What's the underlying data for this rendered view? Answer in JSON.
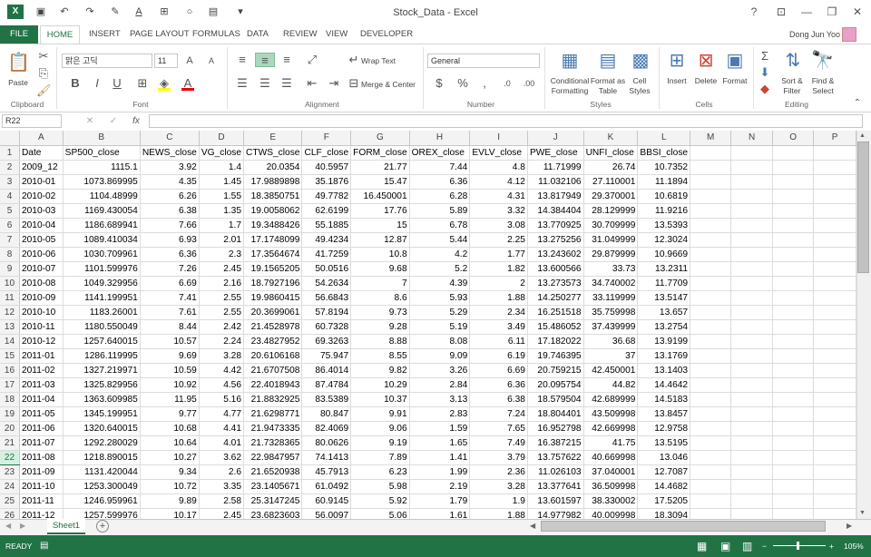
{
  "titlebar": {
    "title": "Stock_Data - Excel",
    "help": "?",
    "minimize": "—",
    "restore": "❐",
    "close": "✕",
    "ribbon_display": "⊡"
  },
  "tabs": {
    "file": "FILE",
    "home": "HOME",
    "insert": "INSERT",
    "page_layout": "PAGE LAYOUT",
    "formulas": "FORMULAS",
    "data": "DATA",
    "review": "REVIEW",
    "view": "VIEW",
    "developer": "DEVELOPER",
    "user": "Dong Jun Yoo"
  },
  "ribbon": {
    "paste": "Paste",
    "clipboard": "Clipboard",
    "font_name": "맑은 고딕",
    "font_size": "11",
    "font": "Font",
    "bold": "B",
    "italic": "I",
    "underline": "U",
    "wrap_text": "Wrap Text",
    "merge_center": "Merge & Center",
    "alignment": "Alignment",
    "number_format": "General",
    "percent": "%",
    "comma": ",",
    "number": "Number",
    "cond_fmt1": "Conditional",
    "cond_fmt2": "Formatting",
    "fmt_table1": "Format as",
    "fmt_table2": "Table",
    "cell_styles1": "Cell",
    "cell_styles2": "Styles",
    "styles": "Styles",
    "insert": "Insert",
    "delete": "Delete",
    "format": "Format",
    "cells": "Cells",
    "sort1": "Sort &",
    "sort2": "Filter",
    "find1": "Find &",
    "find2": "Select",
    "editing": "Editing"
  },
  "formula": {
    "namebox": "R22",
    "fx": "fx",
    "cancel": "✕",
    "enter": "✓",
    "value": ""
  },
  "columns": [
    "A",
    "B",
    "C",
    "D",
    "E",
    "F",
    "G",
    "H",
    "I",
    "J",
    "K",
    "L",
    "M",
    "N",
    "O",
    "P"
  ],
  "rows": [
    [
      "Date",
      "SP500_close",
      "NEWS_close",
      "VG_close",
      "CTWS_close",
      "CLF_close",
      "FORM_close",
      "OREX_close",
      "EVLV_close",
      "PWE_close",
      "UNFI_close",
      "BBSI_close"
    ],
    [
      "2009_12",
      "1115.1",
      "3.92",
      "1.4",
      "20.0354",
      "40.5957",
      "21.77",
      "7.44",
      "4.8",
      "11.71999",
      "26.74",
      "10.7352"
    ],
    [
      "2010-01",
      "1073.869995",
      "4.35",
      "1.45",
      "17.9889898",
      "35.1876",
      "15.47",
      "6.36",
      "4.12",
      "11.032106",
      "27.110001",
      "11.1894"
    ],
    [
      "2010-02",
      "1104.48999",
      "6.26",
      "1.55",
      "18.3850751",
      "49.7782",
      "16.450001",
      "6.28",
      "4.31",
      "13.817949",
      "29.370001",
      "10.6819"
    ],
    [
      "2010-03",
      "1169.430054",
      "6.38",
      "1.35",
      "19.0058062",
      "62.6199",
      "17.76",
      "5.89",
      "3.32",
      "14.384404",
      "28.129999",
      "11.9216"
    ],
    [
      "2010-04",
      "1186.689941",
      "7.66",
      "1.7",
      "19.3488426",
      "55.1885",
      "15",
      "6.78",
      "3.08",
      "13.770925",
      "30.709999",
      "13.5393"
    ],
    [
      "2010-05",
      "1089.410034",
      "6.93",
      "2.01",
      "17.1748099",
      "49.4234",
      "12.87",
      "5.44",
      "2.25",
      "13.275256",
      "31.049999",
      "12.3024"
    ],
    [
      "2010-06",
      "1030.709961",
      "6.36",
      "2.3",
      "17.3564674",
      "41.7259",
      "10.8",
      "4.2",
      "1.77",
      "13.243602",
      "29.879999",
      "10.9669"
    ],
    [
      "2010-07",
      "1101.599976",
      "7.26",
      "2.45",
      "19.1565205",
      "50.0516",
      "9.68",
      "5.2",
      "1.82",
      "13.600566",
      "33.73",
      "13.2311"
    ],
    [
      "2010-08",
      "1049.329956",
      "6.69",
      "2.16",
      "18.7927196",
      "54.2634",
      "7",
      "4.39",
      "2",
      "13.273573",
      "34.740002",
      "11.7709"
    ],
    [
      "2010-09",
      "1141.199951",
      "7.41",
      "2.55",
      "19.9860415",
      "56.6843",
      "8.6",
      "5.93",
      "1.88",
      "14.250277",
      "33.119999",
      "13.5147"
    ],
    [
      "2010-10",
      "1183.26001",
      "7.61",
      "2.55",
      "20.3699061",
      "57.8194",
      "9.73",
      "5.29",
      "2.34",
      "16.251518",
      "35.759998",
      "13.657"
    ],
    [
      "2010-11",
      "1180.550049",
      "8.44",
      "2.42",
      "21.4528978",
      "60.7328",
      "9.28",
      "5.19",
      "3.49",
      "15.486052",
      "37.439999",
      "13.2754"
    ],
    [
      "2010-12",
      "1257.640015",
      "10.57",
      "2.24",
      "23.4827952",
      "69.3263",
      "8.88",
      "8.08",
      "6.11",
      "17.182022",
      "36.68",
      "13.9199"
    ],
    [
      "2011-01",
      "1286.119995",
      "9.69",
      "3.28",
      "20.6106168",
      "75.947",
      "8.55",
      "9.09",
      "6.19",
      "19.746395",
      "37",
      "13.1769"
    ],
    [
      "2011-02",
      "1327.219971",
      "10.59",
      "4.42",
      "21.6707508",
      "86.4014",
      "9.82",
      "3.26",
      "6.69",
      "20.759215",
      "42.450001",
      "13.1403"
    ],
    [
      "2011-03",
      "1325.829956",
      "10.92",
      "4.56",
      "22.4018943",
      "87.4784",
      "10.29",
      "2.84",
      "6.36",
      "20.095754",
      "44.82",
      "14.4642"
    ],
    [
      "2011-04",
      "1363.609985",
      "11.95",
      "5.16",
      "21.8832925",
      "83.5389",
      "10.37",
      "3.13",
      "6.38",
      "18.579504",
      "42.689999",
      "14.5183"
    ],
    [
      "2011-05",
      "1345.199951",
      "9.77",
      "4.77",
      "21.6298771",
      "80.847",
      "9.91",
      "2.83",
      "7.24",
      "18.804401",
      "43.509998",
      "13.8457"
    ],
    [
      "2011-06",
      "1320.640015",
      "10.68",
      "4.41",
      "21.9473335",
      "82.4069",
      "9.06",
      "1.59",
      "7.65",
      "16.952798",
      "42.669998",
      "12.9758"
    ],
    [
      "2011-07",
      "1292.280029",
      "10.64",
      "4.01",
      "21.7328365",
      "80.0626",
      "9.19",
      "1.65",
      "7.49",
      "16.387215",
      "41.75",
      "13.5195"
    ],
    [
      "2011-08",
      "1218.890015",
      "10.27",
      "3.62",
      "22.9847957",
      "74.1413",
      "7.89",
      "1.41",
      "3.79",
      "13.757622",
      "40.669998",
      "13.046"
    ],
    [
      "2011-09",
      "1131.420044",
      "9.34",
      "2.6",
      "21.6520938",
      "45.7913",
      "6.23",
      "1.99",
      "2.36",
      "11.026103",
      "37.040001",
      "12.7087"
    ],
    [
      "2011-10",
      "1253.300049",
      "10.72",
      "3.35",
      "23.1405671",
      "61.0492",
      "5.98",
      "2.19",
      "3.28",
      "13.377641",
      "36.509998",
      "14.4682"
    ],
    [
      "2011-11",
      "1246.959961",
      "9.89",
      "2.58",
      "25.3147245",
      "60.9145",
      "5.92",
      "1.79",
      "1.9",
      "13.601597",
      "38.330002",
      "17.5205"
    ],
    [
      "2011-12",
      "1257.599976",
      "10.17",
      "2.45",
      "23.6823603",
      "56.0097",
      "5.06",
      "1.61",
      "1.88",
      "14.977982",
      "40.009998",
      "18.3094"
    ]
  ],
  "sheet": {
    "name": "Sheet1",
    "add": "+"
  },
  "status": {
    "ready": "READY",
    "zoom": "105%",
    "minus": "−",
    "plus": "+"
  }
}
